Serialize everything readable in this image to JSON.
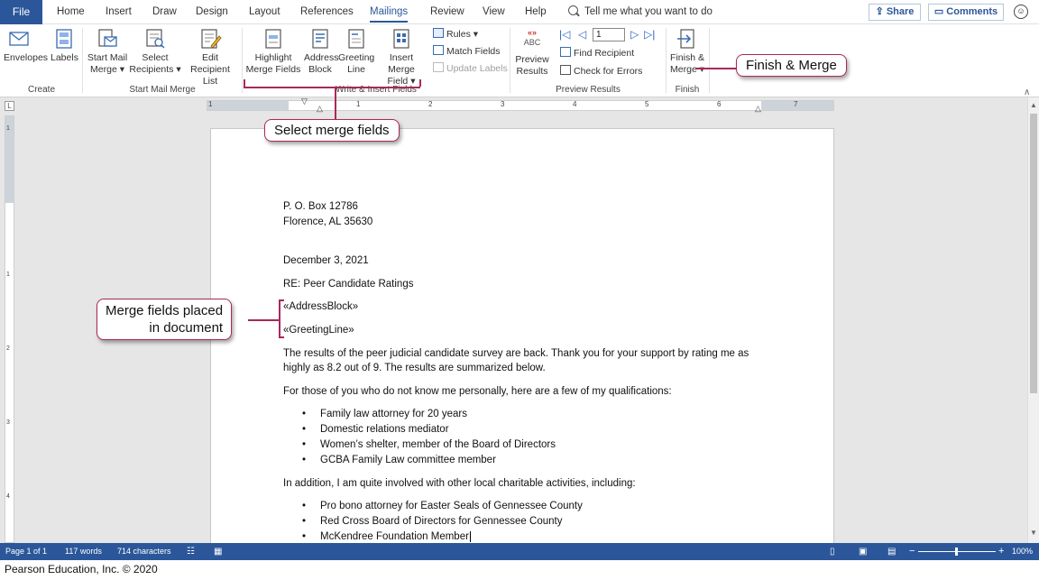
{
  "tabs": {
    "file": "File",
    "items": [
      "Home",
      "Insert",
      "Draw",
      "Design",
      "Layout",
      "References",
      "Mailings",
      "Review",
      "View",
      "Help"
    ],
    "active": "Mailings",
    "tell_me": "Tell me what you want to do",
    "share": "Share",
    "comments": "Comments"
  },
  "ribbon": {
    "create": {
      "label": "Create",
      "envelopes": "Envelopes",
      "labels": "Labels"
    },
    "start_mail_merge": {
      "label": "Start Mail Merge",
      "start_l1": "Start Mail",
      "start_l2": "Merge ▾",
      "select_l1": "Select",
      "select_l2": "Recipients ▾",
      "edit_l1": "Edit",
      "edit_l2": "Recipient List"
    },
    "write_insert": {
      "label": "Write & Insert Fields",
      "highlight_l1": "Highlight",
      "highlight_l2": "Merge Fields",
      "address_l1": "Address",
      "address_l2": "Block",
      "greeting_l1": "Greeting",
      "greeting_l2": "Line",
      "insert_l1": "Insert Merge",
      "insert_l2": "Field ▾",
      "rules": "Rules ▾",
      "match_fields": "Match Fields",
      "update_labels": "Update Labels"
    },
    "preview": {
      "label": "Preview Results",
      "abc": "ABC",
      "preview_l1": "Preview",
      "preview_l2": "Results",
      "record": "1",
      "find_recipient": "Find Recipient",
      "check_errors": "Check for Errors"
    },
    "finish": {
      "label": "Finish",
      "finish_l1": "Finish &",
      "finish_l2": "Merge ▾"
    }
  },
  "ruler_numbers": [
    "1",
    "1",
    "2",
    "3",
    "4",
    "5",
    "6",
    "7"
  ],
  "vruler_numbers": [
    "1",
    "1",
    "2",
    "3",
    "4"
  ],
  "document": {
    "address_1": "P. O. Box 12786",
    "address_2": "Florence, AL 35630",
    "date": "December 3, 2021",
    "re": "RE: Peer Candidate Ratings",
    "address_block": "«AddressBlock»",
    "greeting_line": "«GreetingLine»",
    "para1_l1": "The results of the peer judicial candidate survey are back. Thank you for your support by rating me as",
    "para1_l2": "highly as 8.2 out of 9. The results are summarized below.",
    "para2": "For those of you who do not know me personally, here are a few of my qualifications:",
    "qualifications": [
      "Family law attorney for 20 years",
      "Domestic relations mediator",
      "Women’s shelter, member of the Board of Directors",
      "GCBA Family Law committee member"
    ],
    "para3": "In addition, I am quite involved with other local charitable activities, including:",
    "activities": [
      "Pro bono attorney for Easter Seals of Gennessee County",
      "Red Cross Board of Directors for Gennessee County",
      "McKendree Foundation Member"
    ]
  },
  "status": {
    "page": "Page 1 of 1",
    "words": "117 words",
    "chars": "714 characters",
    "zoom": "100%"
  },
  "callouts": {
    "finish_merge": "Finish & Merge",
    "select_fields": "Select merge fields",
    "placed_l1": "Merge fields placed",
    "placed_l2": "in document"
  },
  "credit": "Pearson Education, Inc. © 2020",
  "colors": {
    "accent": "#2b579a",
    "callout_border": "#a8295b"
  }
}
